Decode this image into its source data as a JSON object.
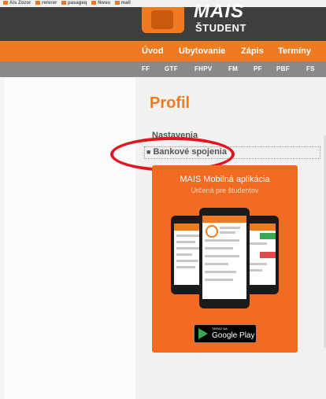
{
  "bookmarks": [
    "Ais Zozor",
    "rererer",
    "pasageq",
    "Nwsu",
    "mall"
  ],
  "header": {
    "logo": "MAIS",
    "subtitle": "ŠTUDENT"
  },
  "nav": {
    "items": [
      "Úvod",
      "Ubytovanie",
      "Zápis",
      "Termíny"
    ]
  },
  "faculties": [
    "FF",
    "GTF",
    "FHPV",
    "FM",
    "PF",
    "PBF",
    "FS"
  ],
  "page": {
    "title": "Profil",
    "menu": [
      "Nastavenia",
      "Bankové spojenia"
    ]
  },
  "promo": {
    "title": "MAIS Mobilná aplikácia",
    "subtitle": "Určená pre študentov",
    "store_small": "TERAZ NA",
    "store_big": "Google Play"
  },
  "colors": {
    "accent": "#f07a22",
    "header": "#3e3e3e",
    "faculty_bar": "#8a8a8a",
    "annotation": "#e6121f"
  }
}
